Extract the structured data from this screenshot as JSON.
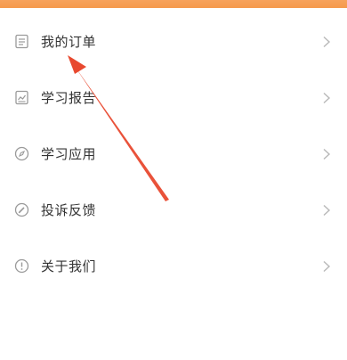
{
  "colors": {
    "header_orange": "#f59a4c",
    "text": "#333333",
    "icon": "#9a9a9a",
    "chevron": "#b8b8b8",
    "annotation_arrow": "#e8492f"
  },
  "menu": {
    "items": [
      {
        "label": "我的订单",
        "icon": "document-icon"
      },
      {
        "label": "学习报告",
        "icon": "report-chart-icon"
      },
      {
        "label": "学习应用",
        "icon": "compass-icon"
      },
      {
        "label": "投诉反馈",
        "icon": "pen-icon"
      },
      {
        "label": "关于我们",
        "icon": "info-icon"
      }
    ]
  },
  "annotation": {
    "icon": "red-arrow-icon"
  }
}
